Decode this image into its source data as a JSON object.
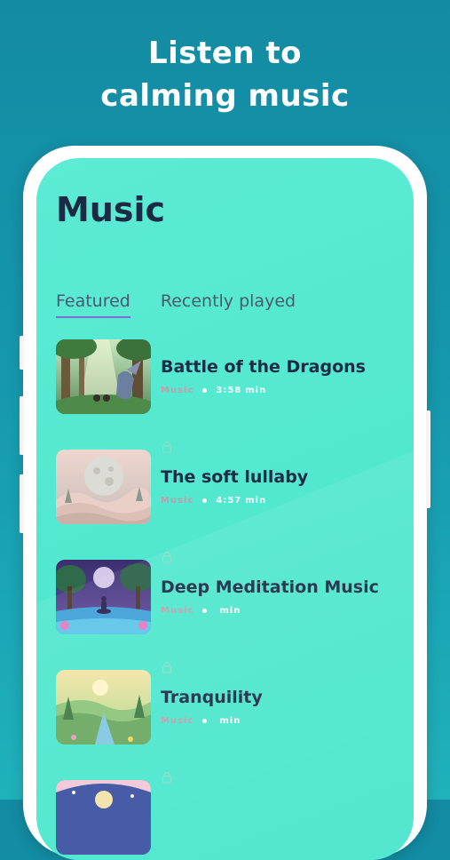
{
  "headline": {
    "line1": "Listen to",
    "line2": "calming music"
  },
  "screen": {
    "title": "Music",
    "tabs": [
      {
        "label": "Featured",
        "active": true
      },
      {
        "label": "Recently played",
        "active": false
      }
    ]
  },
  "tracks": [
    {
      "title": "Battle of the Dragons",
      "category": "Music",
      "duration": "3:58",
      "unit": "min",
      "locked": false,
      "thumb_icon": "forest-dragon-art"
    },
    {
      "title": "The soft lullaby",
      "category": "Music",
      "duration": "4:57",
      "unit": "min",
      "locked": true,
      "thumb_icon": "moon-night-art"
    },
    {
      "title": "Deep Meditation Music",
      "category": "Music",
      "duration": "",
      "unit": "min",
      "locked": true,
      "thumb_icon": "meditation-lake-art"
    },
    {
      "title": "Tranquility",
      "category": "Music",
      "duration": "",
      "unit": "min",
      "locked": true,
      "thumb_icon": "valley-river-art"
    },
    {
      "title": "",
      "category": "",
      "duration": "",
      "unit": "",
      "locked": true,
      "thumb_icon": "moon-night-art"
    }
  ],
  "colors": {
    "background_top": "#138ba3",
    "screen": "#52e8cf",
    "title_text": "#1c2b44",
    "tab_underline": "#7a70c8",
    "category_text": "#c79aab"
  }
}
